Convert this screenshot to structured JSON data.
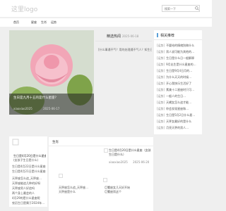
{
  "header": {
    "logo": "这里logo",
    "search_placeholder": "搜索一下"
  },
  "nav": {
    "items": [
      "首页",
      "星座",
      "生肖",
      "运势"
    ]
  },
  "hero": {
    "title": "生日是九月十五的是什么星座？",
    "author": "xiaoxiao2025",
    "date": "2025-06-17"
  },
  "featured": {
    "title": "精选热闻",
    "date": "2025-06-18",
    "item": "[什么事通不气？用的处理通不气人？知生日…"
  },
  "sidebar": {
    "title": "相关推荐",
    "rows": [
      {
        "tag": "[运势]",
        "text": "不要给的情绪别做什么"
      },
      {
        "tag": "[运势]",
        "text": "男人说可能为其他的…"
      },
      {
        "tag": "[运势]",
        "text": "生日是什么日一般解释"
      },
      {
        "tag": "[运势]",
        "text": "9月出生是什么星座的…"
      },
      {
        "tag": "[运势]",
        "text": "生日是9月4日月的…"
      },
      {
        "tag": "[运势]",
        "text": "为什么天天的时候…"
      },
      {
        "tag": "[运势]",
        "text": "开心我快乐生活好了"
      },
      {
        "tag": "[运势]",
        "text": "素美十二星座时只可…"
      },
      {
        "tag": "[运势]",
        "text": "一般人的生日…"
      },
      {
        "tag": "[运势]",
        "text": "天蝎女怎么追才能…"
      },
      {
        "tag": "[运势]",
        "text": "你会发现星座和…"
      },
      {
        "tag": "[运势]",
        "text": "生日是5月2日什么星…"
      },
      {
        "tag": "[运势]",
        "text": "天秤女最好的是什么"
      },
      {
        "tag": "[运势]",
        "text": "月亮天秤的男人…"
      }
    ]
  },
  "left_card": {
    "title": "生日是4月20日是什么星座",
    "subtitle": "(女孩子生日是什么)",
    "rows": [
      "生日是4月22日是什么星座",
      "生日是4月21日是什么星座",
      "天秤座怎么追_天秤座…",
      "天秤座能追几种的好呀",
      "天秤座男人好追吗",
      "两个身上最会的人",
      "4月29的是什么星座呢",
      "农历生日是属于2024年…"
    ]
  },
  "main_panel": {
    "title": "生肖",
    "item_title": "生日是4月20日是什么星座（女孩生日是什么）",
    "item_author": "xiaoxiao2025",
    "item_date": "2025-06-20",
    "footer_items": [
      "天秤座怎么追_天秤座…",
      "天秤座是什么",
      "巨蟹座女几天好开始",
      "巨蟹座男这个"
    ]
  }
}
